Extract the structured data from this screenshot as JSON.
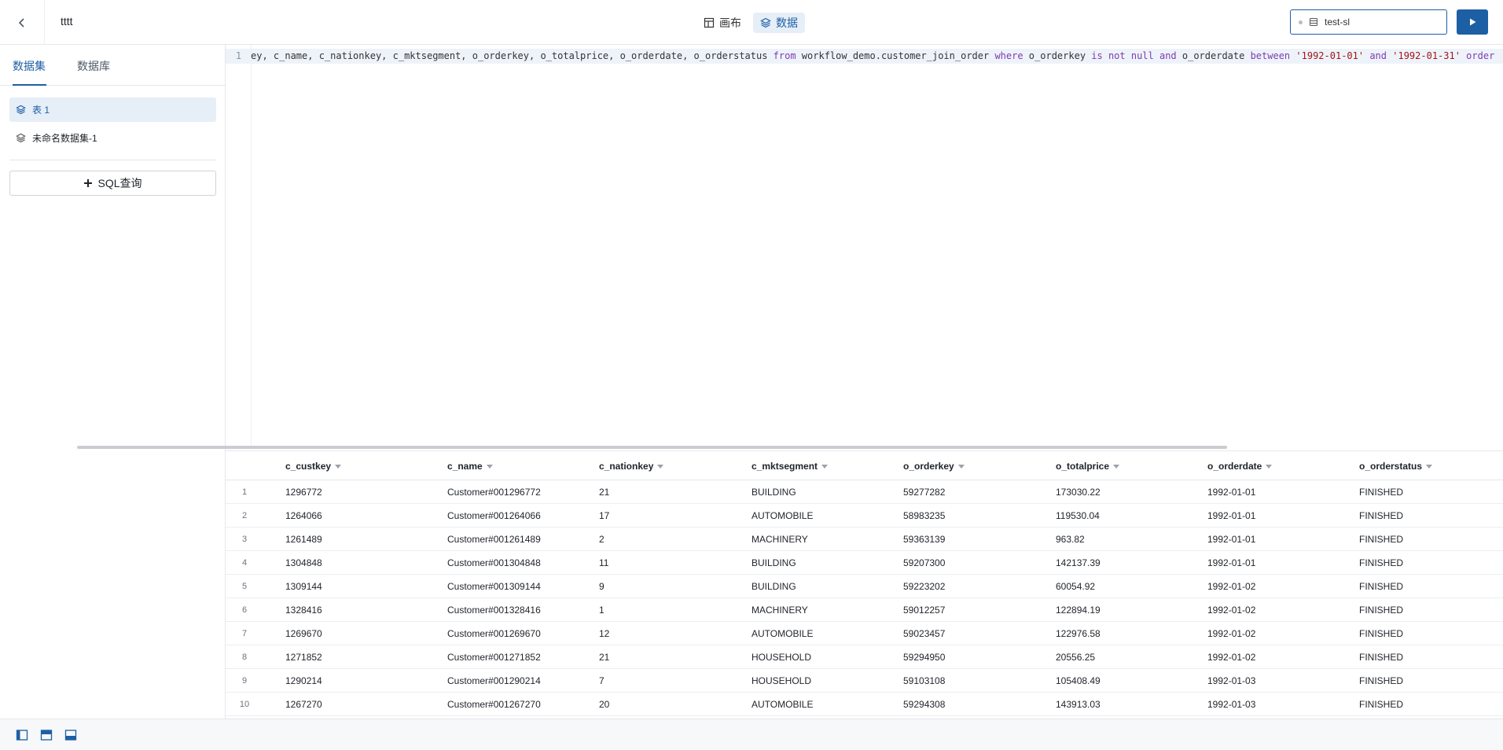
{
  "header": {
    "title": "tttt",
    "view_tabs": [
      {
        "label": "画布",
        "icon": "layout-icon"
      },
      {
        "label": "数据",
        "icon": "layers-icon"
      }
    ],
    "connection": "test-sl"
  },
  "sidebar": {
    "tabs": [
      "数据集",
      "数据库"
    ],
    "datasets": [
      {
        "label": "表 1",
        "active": true
      },
      {
        "label": "未命名数据集-1",
        "active": false
      }
    ],
    "add_sql_label": "SQL查询"
  },
  "editor": {
    "line_number": "1",
    "code_tokens": [
      {
        "t": "ey, c_name, c_nationkey, c_mktsegment, o_orderkey, o_totalprice, o_orderdate, o_orderstatus ",
        "k": ""
      },
      {
        "t": "from",
        "k": "kw"
      },
      {
        "t": " workflow_demo.customer_join_order ",
        "k": ""
      },
      {
        "t": "where",
        "k": "kw"
      },
      {
        "t": " o_orderkey ",
        "k": ""
      },
      {
        "t": "is not null and",
        "k": "kw"
      },
      {
        "t": " o_orderdate ",
        "k": ""
      },
      {
        "t": "between",
        "k": "kw"
      },
      {
        "t": " ",
        "k": ""
      },
      {
        "t": "'1992-01-01'",
        "k": "str"
      },
      {
        "t": " ",
        "k": ""
      },
      {
        "t": "and",
        "k": "kw"
      },
      {
        "t": " ",
        "k": ""
      },
      {
        "t": "'1992-01-31'",
        "k": "str"
      },
      {
        "t": " order by",
        "k": "kw"
      }
    ]
  },
  "table": {
    "columns": [
      "c_custkey",
      "c_name",
      "c_nationkey",
      "c_mktsegment",
      "o_orderkey",
      "o_totalprice",
      "o_orderdate",
      "o_orderstatus"
    ],
    "rows": [
      [
        "1",
        "1296772",
        "Customer#001296772",
        "21",
        "BUILDING",
        "59277282",
        "173030.22",
        "1992-01-01",
        "FINISHED"
      ],
      [
        "2",
        "1264066",
        "Customer#001264066",
        "17",
        "AUTOMOBILE",
        "58983235",
        "119530.04",
        "1992-01-01",
        "FINISHED"
      ],
      [
        "3",
        "1261489",
        "Customer#001261489",
        "2",
        "MACHINERY",
        "59363139",
        "963.82",
        "1992-01-01",
        "FINISHED"
      ],
      [
        "4",
        "1304848",
        "Customer#001304848",
        "11",
        "BUILDING",
        "59207300",
        "142137.39",
        "1992-01-01",
        "FINISHED"
      ],
      [
        "5",
        "1309144",
        "Customer#001309144",
        "9",
        "BUILDING",
        "59223202",
        "60054.92",
        "1992-01-02",
        "FINISHED"
      ],
      [
        "6",
        "1328416",
        "Customer#001328416",
        "1",
        "MACHINERY",
        "59012257",
        "122894.19",
        "1992-01-02",
        "FINISHED"
      ],
      [
        "7",
        "1269670",
        "Customer#001269670",
        "12",
        "AUTOMOBILE",
        "59023457",
        "122976.58",
        "1992-01-02",
        "FINISHED"
      ],
      [
        "8",
        "1271852",
        "Customer#001271852",
        "21",
        "HOUSEHOLD",
        "59294950",
        "20556.25",
        "1992-01-02",
        "FINISHED"
      ],
      [
        "9",
        "1290214",
        "Customer#001290214",
        "7",
        "HOUSEHOLD",
        "59103108",
        "105408.49",
        "1992-01-03",
        "FINISHED"
      ],
      [
        "10",
        "1267270",
        "Customer#001267270",
        "20",
        "AUTOMOBILE",
        "59294308",
        "143913.03",
        "1992-01-03",
        "FINISHED"
      ]
    ]
  },
  "footer": {
    "layout_buttons": [
      "sidebar-layout-icon",
      "top-panel-layout-icon",
      "bottom-panel-layout-icon"
    ]
  },
  "colors": {
    "accent": "#1d5fa5",
    "active_bg": "#e6eef7",
    "keyword": "#7d3bb0",
    "string": "#a31515"
  }
}
